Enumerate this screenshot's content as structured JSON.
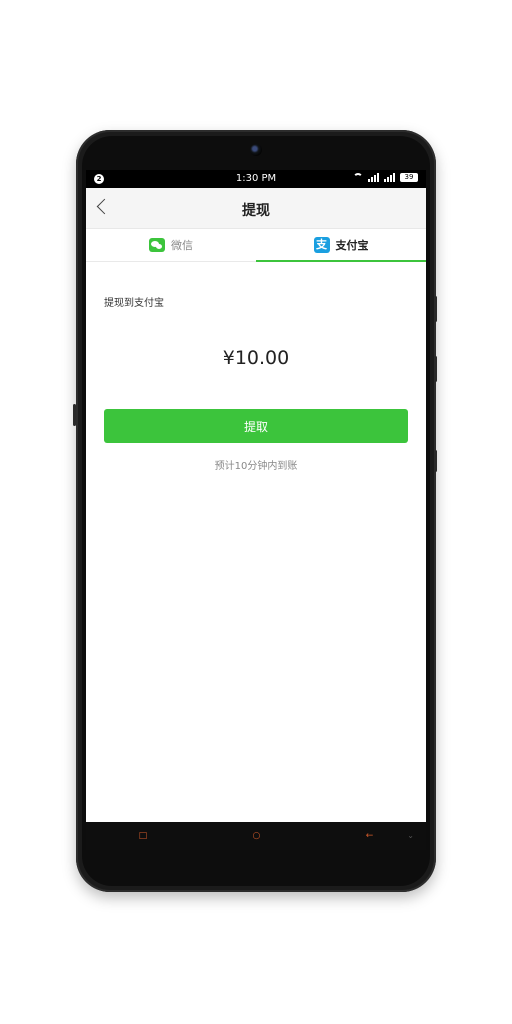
{
  "status_bar": {
    "notification_count": "2",
    "time": "1:30 PM",
    "battery": "39"
  },
  "nav": {
    "title": "提现"
  },
  "tabs": [
    {
      "label": "微信",
      "icon": "wechat-icon",
      "active": false
    },
    {
      "label": "支付宝",
      "icon": "alipay-icon",
      "active": true
    }
  ],
  "content": {
    "section_label": "提现到支付宝",
    "amount": "¥10.00",
    "button_label": "提取",
    "hint": "预计10分钟内到账"
  },
  "colors": {
    "accent": "#3cc43c",
    "alipay": "#1a9fe0",
    "nav_key": "#d25a2a"
  }
}
